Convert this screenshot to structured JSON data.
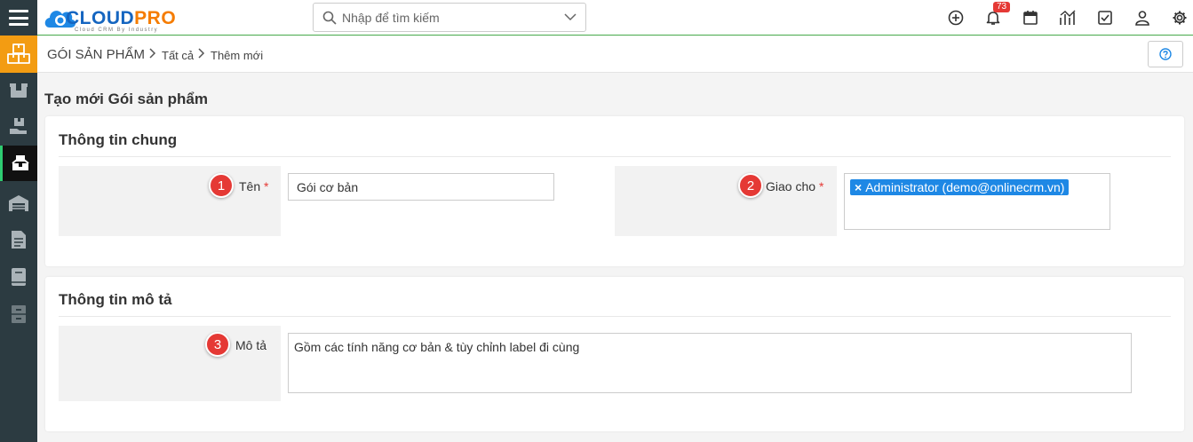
{
  "app": {
    "brand_cloud": "CLOUD",
    "brand_pro": "PRO",
    "brand_tagline": "Cloud CRM By Industry"
  },
  "search": {
    "placeholder": "Nhập để tìm kiếm"
  },
  "notifications": {
    "count": "73"
  },
  "breadcrumb": {
    "module": "GÓI SẢN PHẨM",
    "level1": "Tất cả",
    "level2": "Thêm mới"
  },
  "page": {
    "title": "Tạo mới Gói sản phẩm"
  },
  "section_general": {
    "title": "Thông tin chung",
    "name_label": "Tên",
    "name_step": "1",
    "name_value": "Gói cơ bản",
    "assign_label": "Giao cho",
    "assign_step": "2",
    "assign_chip": "Administrator (demo@onlinecrm.vn)",
    "required_mark": "*",
    "chip_remove": "×"
  },
  "section_desc": {
    "title": "Thông tin mô tả",
    "desc_label": "Mô tả",
    "desc_step": "3",
    "desc_value": "Gồm các tính năng cơ bản & tùy chỉnh label đi cùng"
  },
  "colors": {
    "rail_bg": "#2c3b41",
    "module_accent": "#f39c12",
    "chip_bg": "#1e88e5",
    "step_red": "#e53935",
    "brand_blue": "#1565c0",
    "brand_orange": "#f57c00"
  },
  "icons": {
    "rail": [
      "menu-icon",
      "packages-icon",
      "box-icon",
      "box-in-hand-icon",
      "bundle-icon",
      "warehouse-icon",
      "document-icon",
      "book-icon",
      "cabinet-icon"
    ],
    "topbar": [
      "add-circle-icon",
      "bell-icon",
      "calendar-icon",
      "chart-icon",
      "task-check-icon",
      "user-icon",
      "gear-icon"
    ]
  }
}
